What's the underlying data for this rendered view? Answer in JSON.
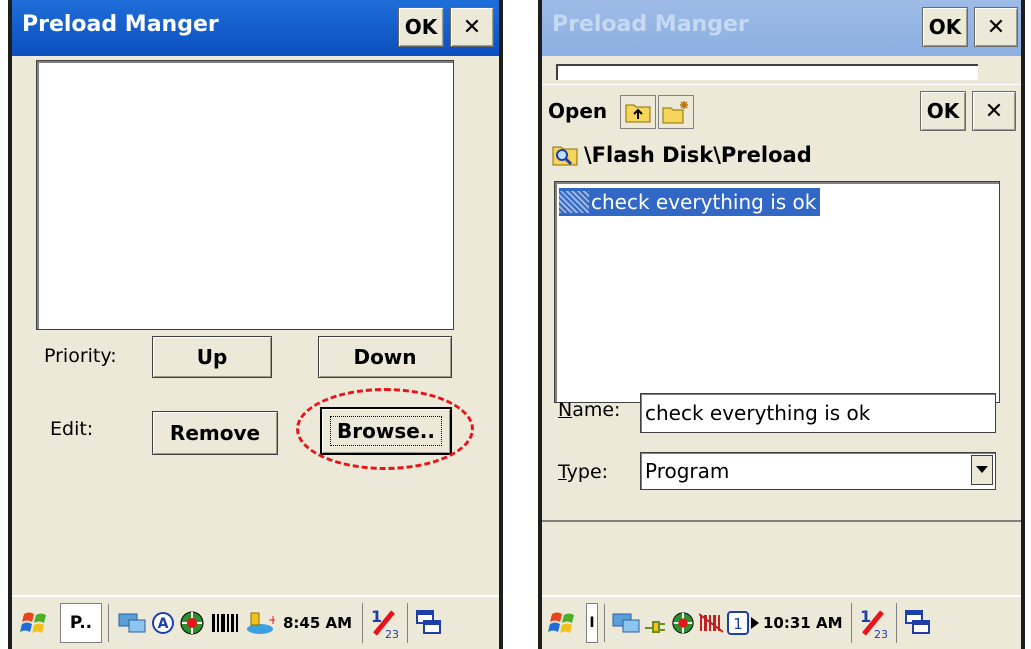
{
  "left_screen": {
    "title": "Preload Manger",
    "ok_label": "OK",
    "close_label": "✕",
    "priority_label": "Priority:",
    "up_button": "Up",
    "down_button": "Down",
    "edit_label": "Edit:",
    "remove_button": "Remove",
    "browse_button": "Browse..",
    "taskbar": {
      "app_button": "P..",
      "clock": "8:45 AM"
    }
  },
  "right_screen": {
    "title": "Preload Manger",
    "ok_label": "OK",
    "close_label": "✕",
    "dialog": {
      "title": "Open",
      "ok_label": "OK",
      "close_label": "✕",
      "path": "\\Flash Disk\\Preload",
      "files": [
        "check everything is ok"
      ],
      "name_label_first": "N",
      "name_label_rest": "ame:",
      "name_value": "check everything is ok",
      "type_label_first": "T",
      "type_label_rest": "ype:",
      "type_value": "Program"
    },
    "taskbar": {
      "app_button": "I",
      "clock": "10:31 AM"
    }
  },
  "colors": {
    "titlebar": "#0a4fbf",
    "highlight": "#e8141c",
    "selection": "#3168c6"
  }
}
